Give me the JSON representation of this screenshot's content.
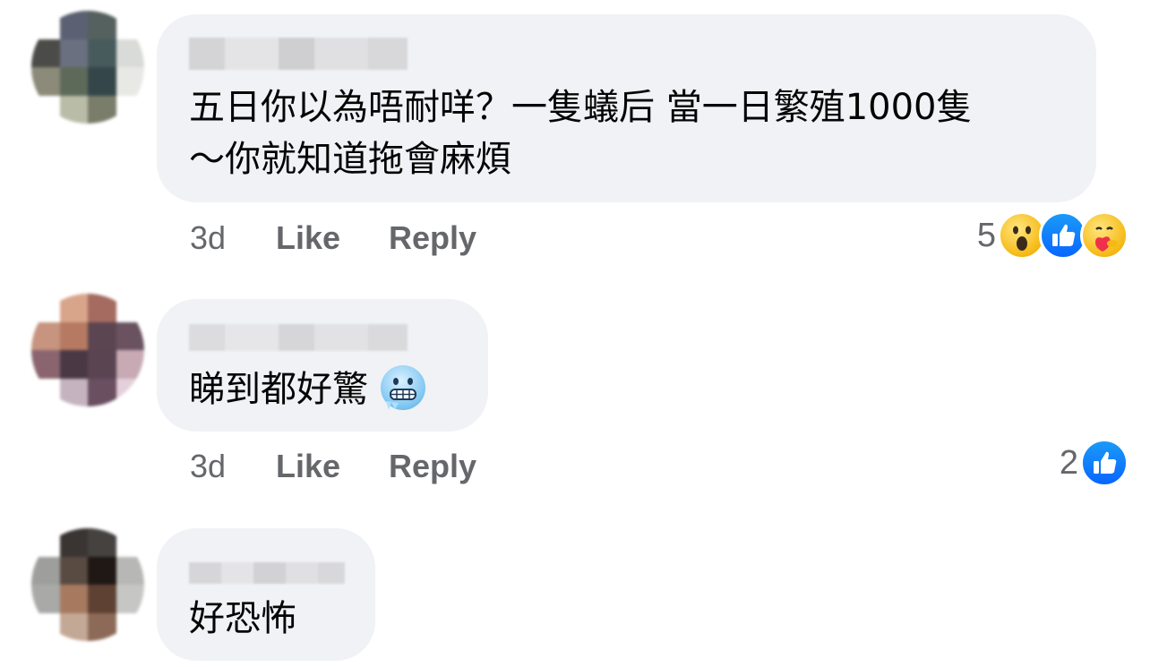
{
  "comments": [
    {
      "text_line1": "五日你以為唔耐咩？一隻蟻后 當一日繁殖1000隻",
      "text_line2": "～你就知道拖會麻煩",
      "time": "3d",
      "like_label": "Like",
      "reply_label": "Reply",
      "reaction_count": "5",
      "reactions": [
        "wow-icon",
        "like-icon",
        "care-icon"
      ]
    },
    {
      "text_line1": "睇到都好驚",
      "emoji": "cold-face-emoji",
      "time": "3d",
      "like_label": "Like",
      "reply_label": "Reply",
      "reaction_count": "2",
      "reactions": [
        "like-icon"
      ]
    },
    {
      "text_line1": "好恐怖"
    }
  ]
}
